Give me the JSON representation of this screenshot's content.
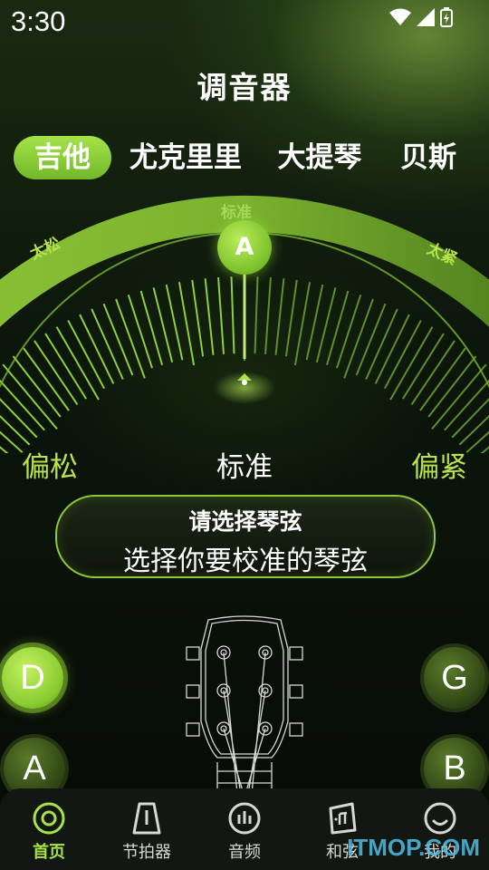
{
  "status": {
    "time": "3:30"
  },
  "title": "调音器",
  "tabs": [
    {
      "label": "吉他",
      "active": true
    },
    {
      "label": "尤克里里",
      "active": false
    },
    {
      "label": "大提琴",
      "active": false
    },
    {
      "label": "贝斯",
      "active": false
    }
  ],
  "gauge": {
    "standard_label": "标准",
    "too_loose": "太松",
    "too_tight": "太紧",
    "note": "A"
  },
  "indicator": {
    "left": "偏松",
    "center": "标准",
    "right": "偏紧"
  },
  "hint": {
    "title": "请选择琴弦",
    "subtitle": "选择你要校准的琴弦"
  },
  "strings": {
    "left": [
      {
        "label": "D",
        "active": true
      },
      {
        "label": "A",
        "active": false
      }
    ],
    "right": [
      {
        "label": "G",
        "active": false
      },
      {
        "label": "B",
        "active": false
      }
    ]
  },
  "nav": [
    {
      "label": "首页",
      "icon": "target-icon",
      "active": true
    },
    {
      "label": "节拍器",
      "icon": "metronome-icon",
      "active": false
    },
    {
      "label": "音频",
      "icon": "audio-bars-icon",
      "active": false
    },
    {
      "label": "和弦",
      "icon": "chord-card-icon",
      "active": false
    },
    {
      "label": "我的",
      "icon": "smile-icon",
      "active": false
    }
  ],
  "watermark": "ITMOP.COM",
  "colors": {
    "accent": "#a6e34a",
    "background": "#0b120a"
  }
}
